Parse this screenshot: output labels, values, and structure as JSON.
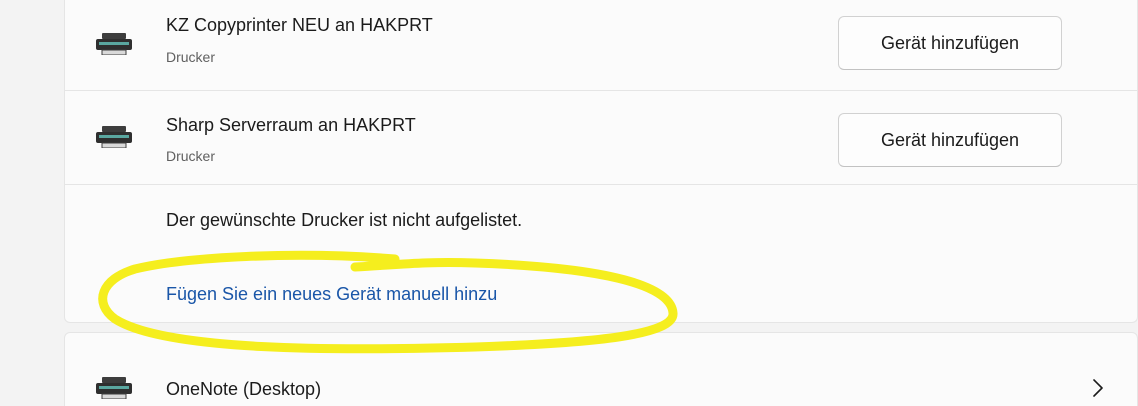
{
  "printers": [
    {
      "name": "KZ Copyprinter NEU an HAKPRT",
      "type": "Drucker",
      "action_label": "Gerät hinzufügen",
      "icon": "printer-icon"
    },
    {
      "name": "Sharp Serverraum an HAKPRT",
      "type": "Drucker",
      "action_label": "Gerät hinzufügen",
      "icon": "printer-icon"
    }
  ],
  "not_listed": {
    "text": "Der gewünschte Drucker ist nicht aufgelistet.",
    "link_label": "Fügen Sie ein neues Gerät manuell hinzu",
    "highlight_color": "#f5ee1e"
  },
  "onenote": {
    "name": "OneNote (Desktop)",
    "icon": "printer-icon",
    "chevron": "chevron-right-icon"
  },
  "colors": {
    "accent_link": "#1a56a8",
    "background": "#f3f3f3",
    "card": "#fbfbfb"
  }
}
